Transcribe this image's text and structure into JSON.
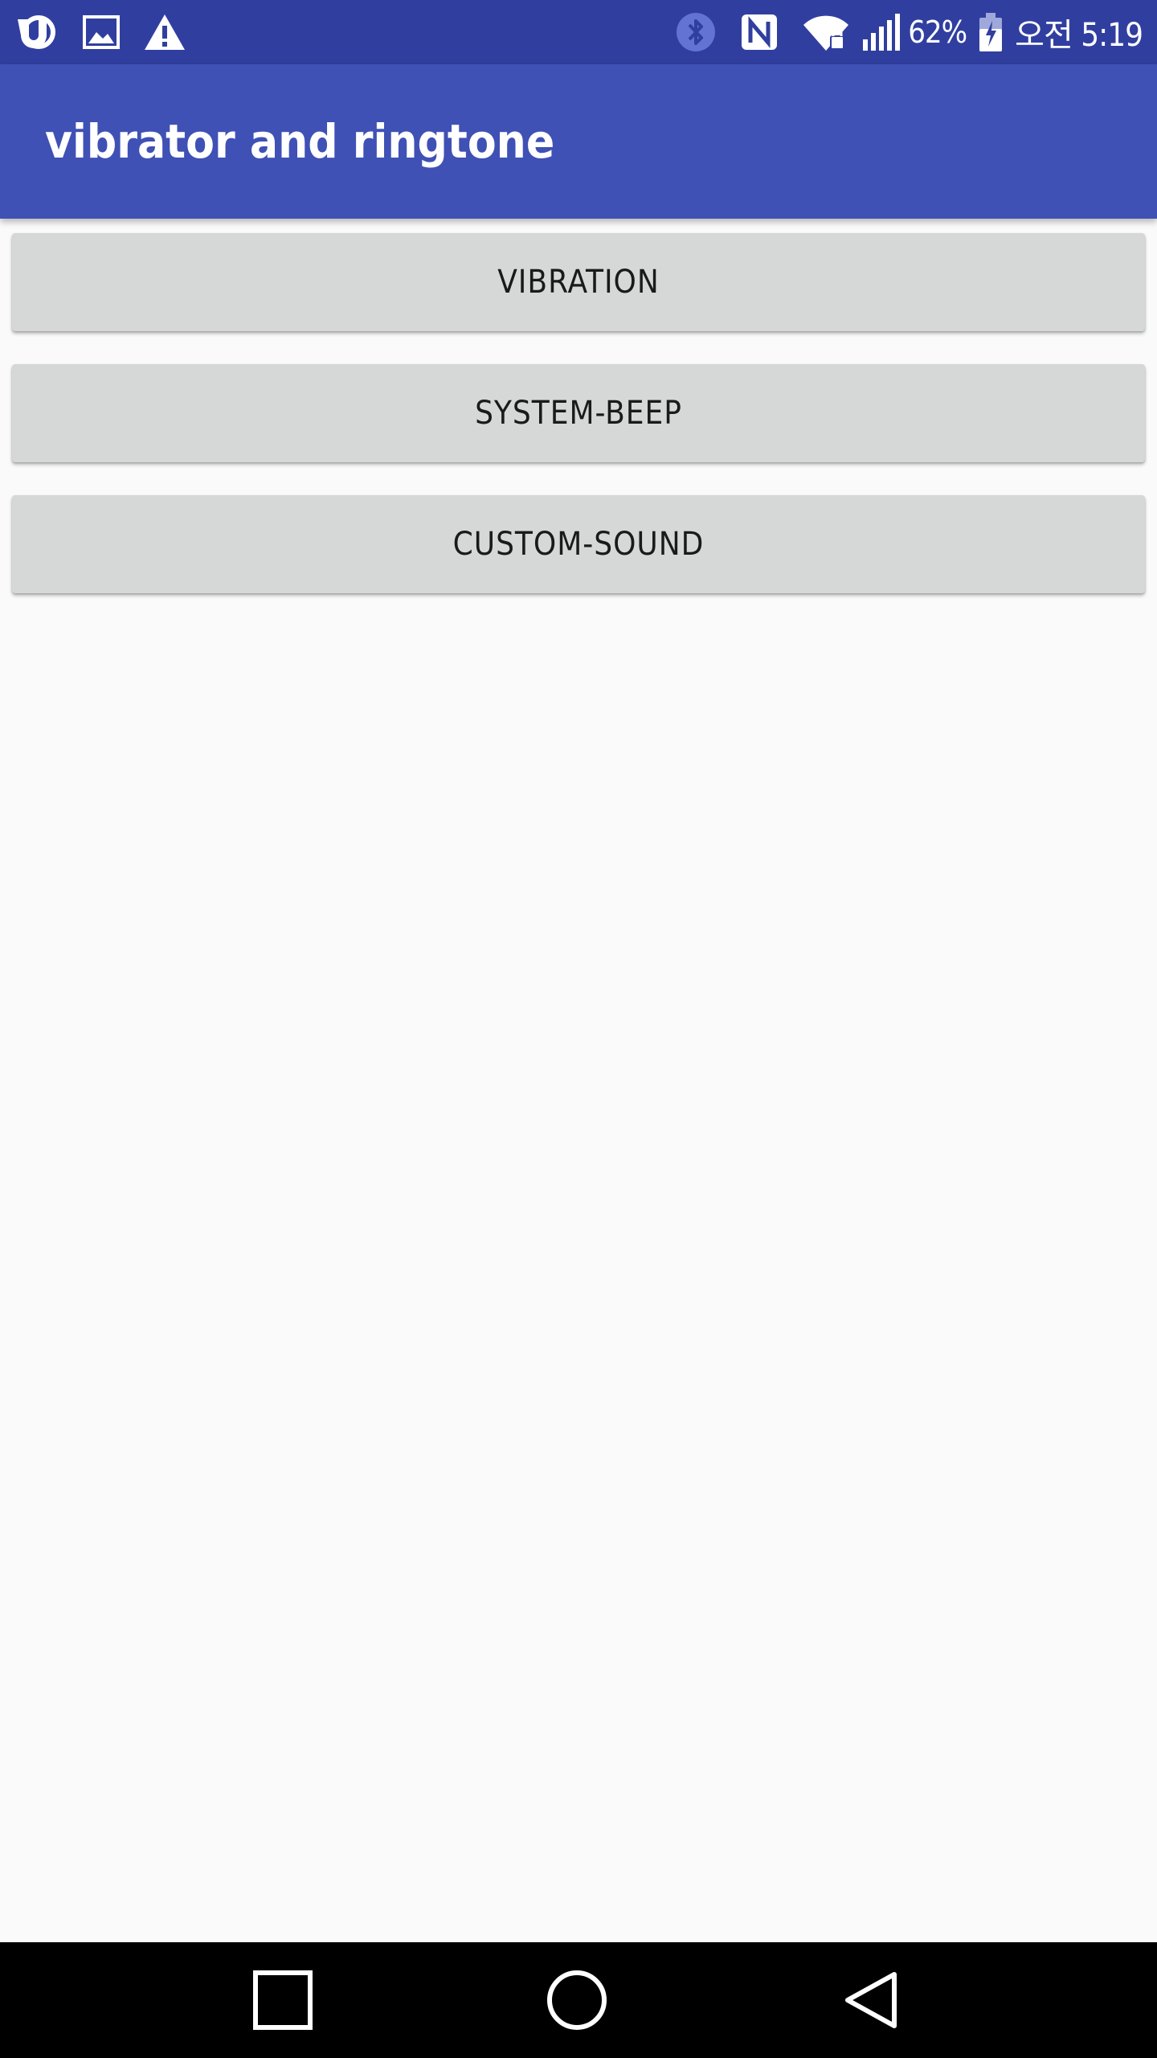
{
  "status_bar": {
    "time": "오전 5:19",
    "battery": "62%",
    "icons": [
      "app-notification-icon",
      "image-icon",
      "warning-icon",
      "bluetooth-icon",
      "nfc-icon",
      "wifi-icon",
      "signal-icon",
      "battery-charging-icon"
    ]
  },
  "app_bar": {
    "title": "vibrator and ringtone",
    "color": "#3f51b5",
    "status_color": "#303f9f"
  },
  "buttons": [
    {
      "label": "VIBRATION"
    },
    {
      "label": "SYSTEM-BEEP"
    },
    {
      "label": "CUSTOM-SOUND"
    }
  ],
  "nav_bar": {
    "icons": [
      "recent-apps-icon",
      "home-icon",
      "back-icon"
    ]
  }
}
